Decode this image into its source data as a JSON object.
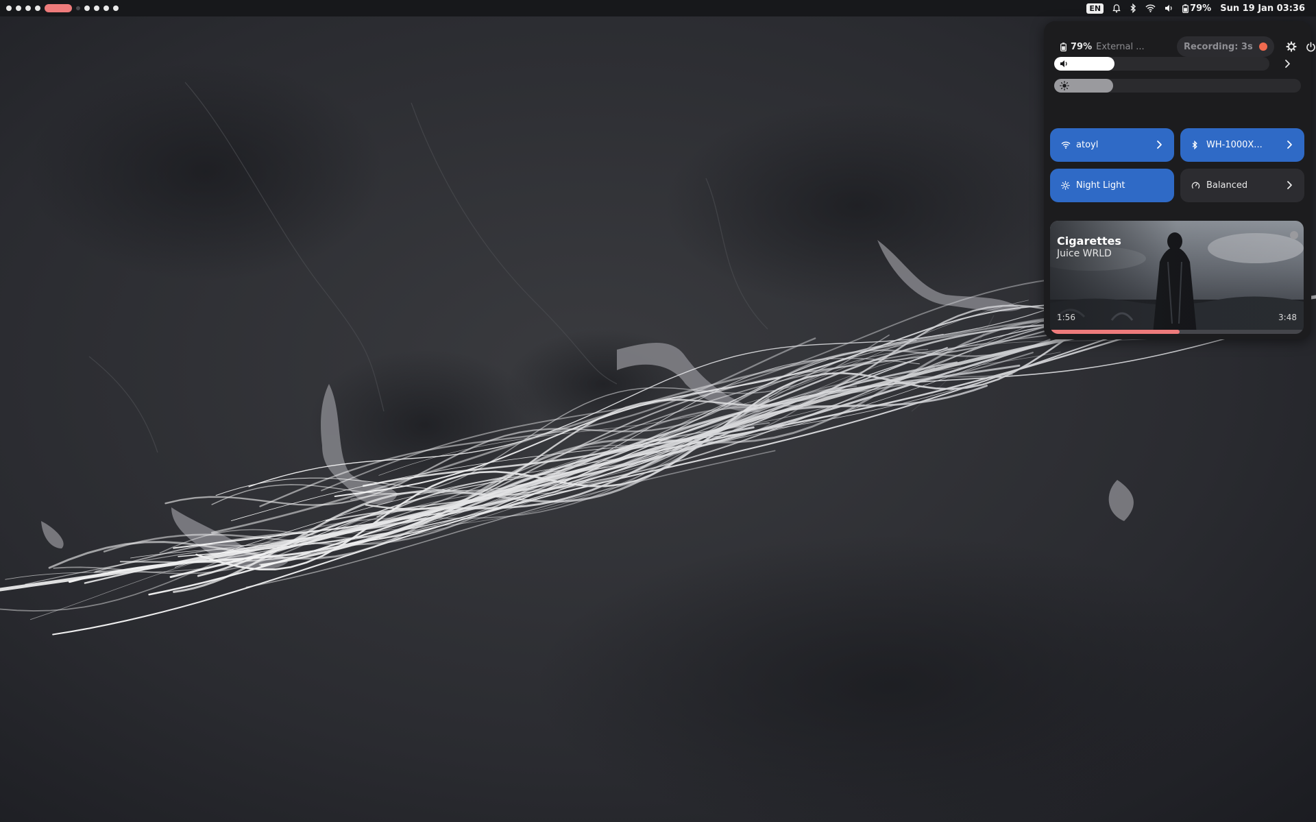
{
  "top_bar": {
    "workspaces": {
      "active_index": 4,
      "count": 10
    },
    "language": "EN",
    "icons": [
      "bell-icon",
      "bluetooth-icon",
      "wifi-icon",
      "volume-icon",
      "battery-icon"
    ],
    "battery": "79%",
    "clock": "Sun 19 Jan 03:36",
    "accent": "#ee7b7b"
  },
  "panel": {
    "battery_percent": "79%",
    "battery_source": "External ...",
    "recording_label": "Recording: 3s",
    "recording_dot_color": "#f06a4f",
    "volume_level": 0.28,
    "brightness_level": 0.24,
    "tiles": [
      {
        "label": "atoyl",
        "icon": "wifi-icon",
        "active": true
      },
      {
        "label": "WH-1000X...",
        "icon": "bluetooth-icon",
        "active": true
      },
      {
        "label": "Night Light",
        "icon": "sun-icon",
        "active": true
      },
      {
        "label": "Balanced",
        "icon": "power-profile-icon",
        "active": false
      }
    ],
    "tile_active_color": "#2f6ac6",
    "media": {
      "title": "Cigarettes",
      "artist": "Juice WRLD",
      "elapsed": "1:56",
      "duration": "3:48",
      "progress": 0.51
    }
  }
}
